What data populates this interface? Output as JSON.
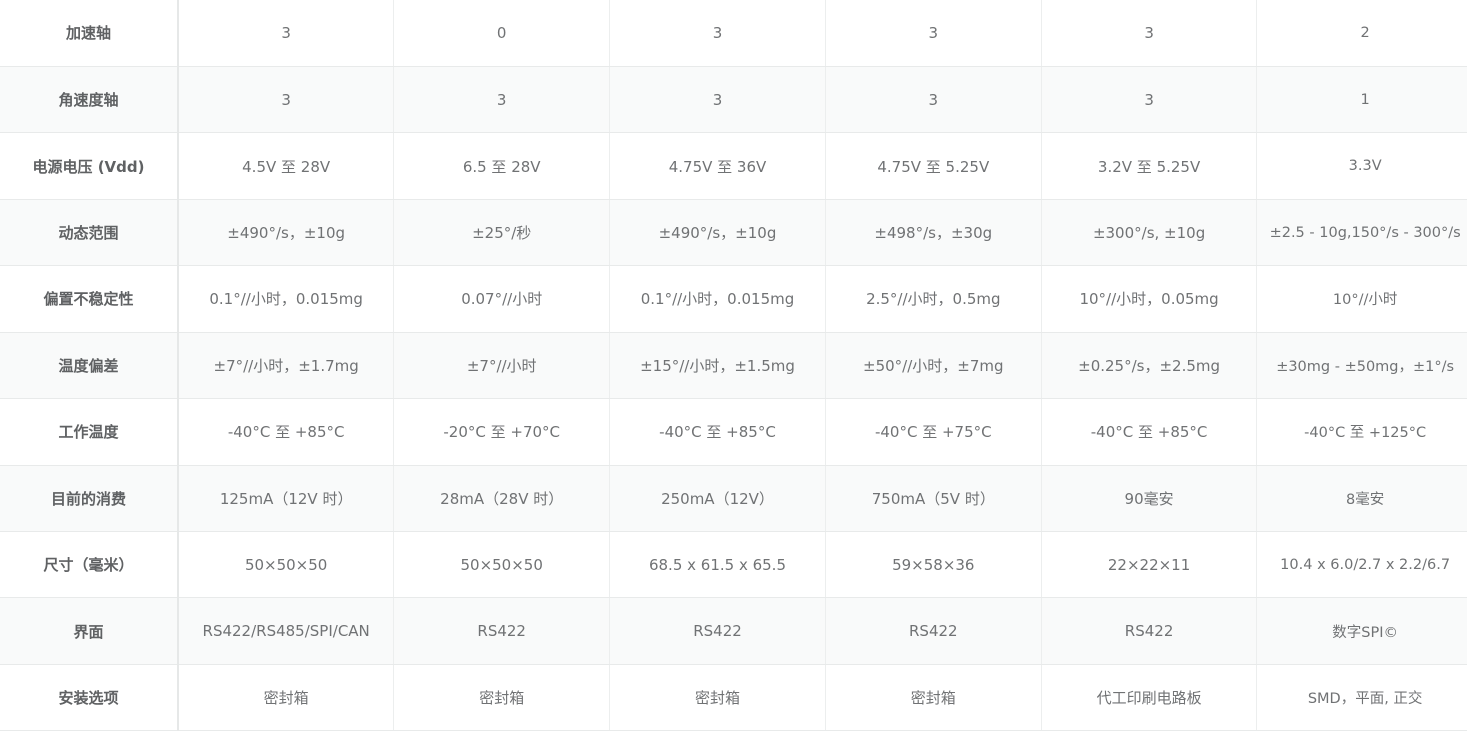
{
  "rows": [
    {
      "label": "加速轴",
      "values": [
        "3",
        "0",
        "3",
        "3",
        "3",
        "2"
      ]
    },
    {
      "label": "角速度轴",
      "values": [
        "3",
        "3",
        "3",
        "3",
        "3",
        "1"
      ]
    },
    {
      "label": "电源电压 (Vdd)",
      "values": [
        "4.5V 至 28V",
        "6.5 至 28V",
        "4.75V 至 36V",
        "4.75V 至 5.25V",
        "3.2V 至 5.25V",
        "3.3V"
      ]
    },
    {
      "label": "动态范围",
      "values": [
        "±490°/s，±10g",
        "±25°/秒",
        "±490°/s，±10g",
        "±498°/s，±30g",
        "±300°/s, ±10g",
        "±2.5 - 10g,150°/s - 300°/s"
      ]
    },
    {
      "label": "偏置不稳定性",
      "values": [
        "0.1°//小时，0.015mg",
        "0.07°//小时",
        "0.1°//小时，0.015mg",
        "2.5°//小时，0.5mg",
        "10°//小时，0.05mg",
        "10°//小时"
      ]
    },
    {
      "label": "温度偏差",
      "values": [
        "±7°//小时，±1.7mg",
        "±7°//小时",
        "±15°//小时，±1.5mg",
        "±50°//小时，±7mg",
        "±0.25°/s，±2.5mg",
        "±30mg - ±50mg，±1°/s"
      ]
    },
    {
      "label": "工作温度",
      "values": [
        "-40°C 至 +85°C",
        "-20°C 至 +70°C",
        "-40°C 至 +85°C",
        "-40°C 至 +75°C",
        "-40°C 至 +85°C",
        "-40°C 至 +125°C"
      ]
    },
    {
      "label": "目前的消费",
      "values": [
        "125mA（12V 时）",
        "28mA（28V 时）",
        "250mA（12V）",
        "750mA（5V 时）",
        "90毫安",
        "8毫安"
      ]
    },
    {
      "label": "尺寸（毫米）",
      "values": [
        "50×50×50",
        "50×50×50",
        "68.5 x 61.5 x 65.5",
        "59×58×36",
        "22×22×11",
        "10.4 x 6.0/2.7 x 2.2/6.7"
      ]
    },
    {
      "label": "界面",
      "values": [
        "RS422/RS485/SPI/CAN",
        "RS422",
        "RS422",
        "RS422",
        "RS422",
        "数字SPI©"
      ]
    },
    {
      "label": "安装选项",
      "values": [
        "密封箱",
        "密封箱",
        "密封箱",
        "密封箱",
        "代工印刷电路板",
        "SMD，平面, 正交"
      ]
    }
  ]
}
